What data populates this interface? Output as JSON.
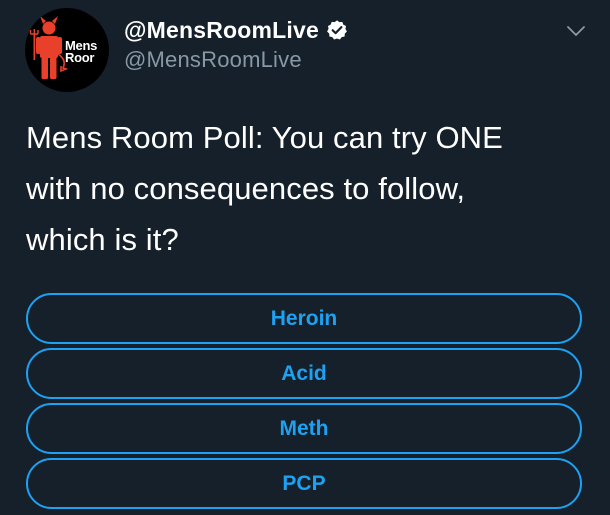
{
  "account": {
    "display_name": "@MensRoomLive",
    "handle": "@MensRoomLive",
    "verified": true,
    "avatar": {
      "icon": "red-devil-mascot-icon",
      "word1": "Mens",
      "word2": "Roor"
    }
  },
  "tweet": {
    "text_line1": "Mens Room Poll: You can try ONE",
    "text_line2": "with no consequences to follow,",
    "text_line3": "which is it?"
  },
  "poll": {
    "options": [
      {
        "label": "Heroin"
      },
      {
        "label": "Acid"
      },
      {
        "label": "Meth"
      },
      {
        "label": "PCP"
      }
    ]
  },
  "icons": {
    "verified": "verified-badge-icon",
    "menu": "chevron-down-icon"
  },
  "colors": {
    "background": "#15202b",
    "accent": "#1da1f2",
    "secondary_text": "#8899a6",
    "avatar_mascot": "#e8402a"
  }
}
